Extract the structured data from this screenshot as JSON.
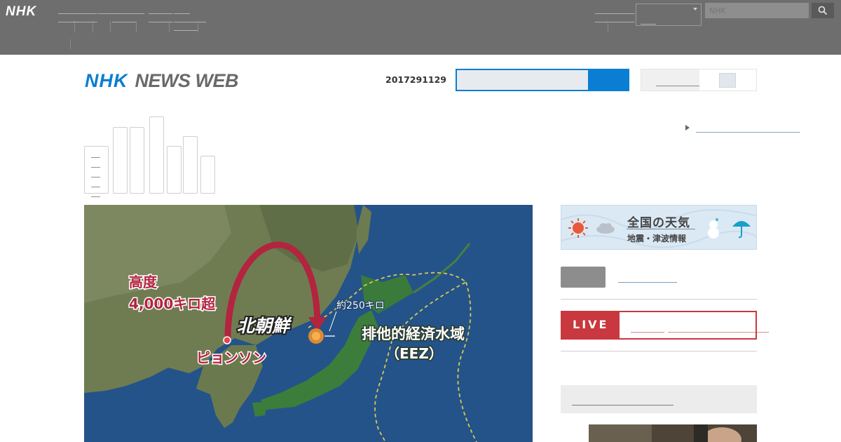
{
  "topbar": {
    "logo": "NHK",
    "nav": [
      {
        "l1": "",
        "l2": "＿＿",
        "l3": "＿＿"
      },
      {
        "l1": "＿＿＿",
        "l2": "＿＿＿",
        "l3": ""
      },
      {
        "l1": "",
        "l2": "＿＿",
        "l3": ""
      },
      {
        "l1": "＿＿＿＿",
        "l2": "＿＿＿",
        "l3": ""
      },
      {
        "l1": "＿＿＿",
        "l2": "＿＿＿",
        "l3": ""
      },
      {
        "l1": "＿＿",
        "l2": "＿＿＿＿",
        "l3": "＿＿＿"
      }
    ],
    "right_nav": [
      {
        "l1": "",
        "l2": "＿＿",
        "l3": "＿＿"
      },
      {
        "l1": "＿＿＿",
        "l2": "＿＿＿",
        "l3": ""
      }
    ],
    "select_value": "＿＿",
    "search_placeholder": "NHK"
  },
  "header": {
    "logo_nhk": "NHK",
    "logo_rest": "NEWS WEB",
    "date_number": "2017291129",
    "search_value": "",
    "toggle_label": "＿＿＿＿＿"
  },
  "categories": {
    "first_label": "＿＿＿＿＿＿＿＿"
  },
  "side_link": "＿＿＿＿＿＿＿＿＿＿＿",
  "main_image": {
    "text_height": "高度",
    "text_altitude": "4,000キロ超",
    "text_north_korea": "北朝鮮",
    "text_pyongyang": "ピョンソン",
    "text_distance": "約250キロ",
    "text_eez": "排他的経済水域",
    "text_eez_abbr": "（EEZ）"
  },
  "weather": {
    "title": "全国の天気",
    "subtitle": "地震・津波情報"
  },
  "links": {
    "grey_link": "＿＿＿＿＿＿"
  },
  "live": {
    "tag": "LIVE",
    "text": "＿＿＿ ＿＿＿＿＿＿＿＿＿"
  },
  "ranking": {
    "header": "＿＿＿＿＿＿＿＿＿＿"
  },
  "colors": {
    "brand_blue": "#0a7ed3",
    "live_red": "#c8383e",
    "topbar_grey": "#6e6e6e"
  }
}
